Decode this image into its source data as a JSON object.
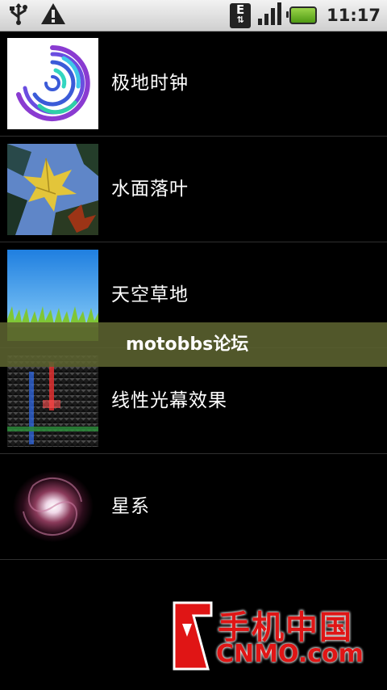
{
  "status_bar": {
    "icons": [
      "usb-icon",
      "warning-icon",
      "edge-data-icon",
      "signal-icon",
      "battery-icon"
    ],
    "edge_letter": "E",
    "time": "11:17"
  },
  "list": {
    "items": [
      {
        "label": "极地时钟",
        "thumb": "polar-clock-thumb"
      },
      {
        "label": "水面落叶",
        "thumb": "water-leaves-thumb"
      },
      {
        "label": "天空草地",
        "thumb": "sky-grass-thumb"
      },
      {
        "label": "线性光幕效果",
        "thumb": "light-curtain-thumb"
      },
      {
        "label": "星系",
        "thumb": "galaxy-thumb"
      }
    ]
  },
  "banner": {
    "text": "motobbs论坛"
  },
  "watermark": {
    "cn": "手机中国",
    "en": "CNMO.com"
  },
  "colors": {
    "banner": "#5c6330",
    "watermark": "#e01515",
    "statusbar": "#dcdcdc"
  }
}
